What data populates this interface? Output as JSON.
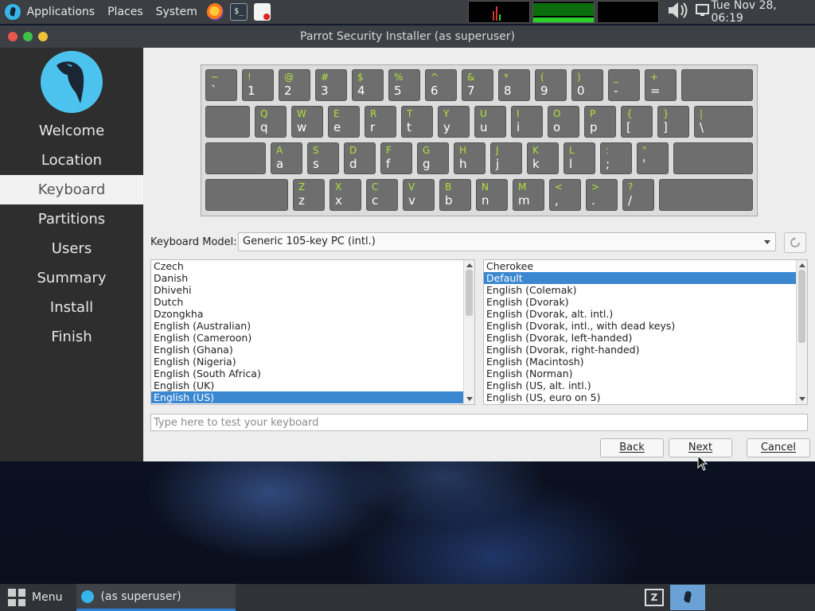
{
  "top_panel": {
    "menu_applications": "Applications",
    "menu_places": "Places",
    "menu_system": "System",
    "terminal_glyph": "$_",
    "clock": "Tue Nov 28, 06:19",
    "icons": [
      "parrot-logo-icon",
      "firefox-icon",
      "terminal-icon",
      "text-editor-icon",
      "system-monitor",
      "volume-icon",
      "display-icon"
    ]
  },
  "window": {
    "title": "Parrot Security Installer (as superuser)"
  },
  "sidebar": {
    "items": [
      "Welcome",
      "Location",
      "Keyboard",
      "Partitions",
      "Users",
      "Summary",
      "Install",
      "Finish"
    ],
    "active": "Keyboard"
  },
  "keyboard_preview": {
    "rows": [
      [
        [
          "~",
          "`"
        ],
        [
          "!",
          "1"
        ],
        [
          "@",
          "2"
        ],
        [
          "#",
          "3"
        ],
        [
          "$",
          "4"
        ],
        [
          "%",
          "5"
        ],
        [
          "^",
          "6"
        ],
        [
          "&",
          "7"
        ],
        [
          "*",
          "8"
        ],
        [
          "(",
          "9"
        ],
        [
          ")",
          "0"
        ],
        [
          "_",
          "-"
        ],
        [
          "+",
          "="
        ],
        [
          "",
          ""
        ]
      ],
      [
        [
          "",
          ""
        ],
        [
          "Q",
          "q"
        ],
        [
          "W",
          "w"
        ],
        [
          "E",
          "e"
        ],
        [
          "R",
          "r"
        ],
        [
          "T",
          "t"
        ],
        [
          "Y",
          "y"
        ],
        [
          "U",
          "u"
        ],
        [
          "I",
          "i"
        ],
        [
          "O",
          "o"
        ],
        [
          "P",
          "p"
        ],
        [
          "{",
          "["
        ],
        [
          "}",
          "]"
        ],
        [
          "|",
          "\\"
        ]
      ],
      [
        [
          "",
          ""
        ],
        [
          "A",
          "a"
        ],
        [
          "S",
          "s"
        ],
        [
          "D",
          "d"
        ],
        [
          "F",
          "f"
        ],
        [
          "G",
          "g"
        ],
        [
          "H",
          "h"
        ],
        [
          "J",
          "j"
        ],
        [
          "K",
          "k"
        ],
        [
          "L",
          "l"
        ],
        [
          ":",
          ";"
        ],
        [
          "\"",
          "'"
        ],
        [
          "",
          ""
        ]
      ],
      [
        [
          "",
          ""
        ],
        [
          "Z",
          "z"
        ],
        [
          "X",
          "x"
        ],
        [
          "C",
          "c"
        ],
        [
          "V",
          "v"
        ],
        [
          "B",
          "b"
        ],
        [
          "N",
          "n"
        ],
        [
          "M",
          "m"
        ],
        [
          "<",
          ","
        ],
        [
          ">",
          "."
        ],
        [
          "?",
          "/"
        ],
        [
          "",
          ""
        ]
      ]
    ]
  },
  "model": {
    "label": "Keyboard Model:",
    "value": "Generic 105-key PC (intl.)"
  },
  "layouts": {
    "items": [
      "Czech",
      "Danish",
      "Dhivehi",
      "Dutch",
      "Dzongkha",
      "English (Australian)",
      "English (Cameroon)",
      "English (Ghana)",
      "English (Nigeria)",
      "English (South Africa)",
      "English (UK)",
      "English (US)"
    ],
    "selected": "English (US)"
  },
  "variants": {
    "items": [
      "Cherokee",
      "Default",
      "English (Colemak)",
      "English (Dvorak)",
      "English (Dvorak, alt. intl.)",
      "English (Dvorak, intl., with dead keys)",
      "English (Dvorak, left-handed)",
      "English (Dvorak, right-handed)",
      "English (Macintosh)",
      "English (Norman)",
      "English (US, alt. intl.)",
      "English (US, euro on 5)"
    ],
    "selected": "Default"
  },
  "test_input": {
    "placeholder": "Type here to test your keyboard",
    "value": ""
  },
  "buttons": {
    "back_label": "Back",
    "next_label": "Next",
    "cancel_label": "Cancel"
  },
  "bottom_panel": {
    "menu_label": "Menu",
    "task_label": "(as superuser)"
  },
  "colors": {
    "accent": "#3b87d0",
    "logo_blue": "#4cc3ef",
    "key_shift_label": "#b2e23a"
  }
}
